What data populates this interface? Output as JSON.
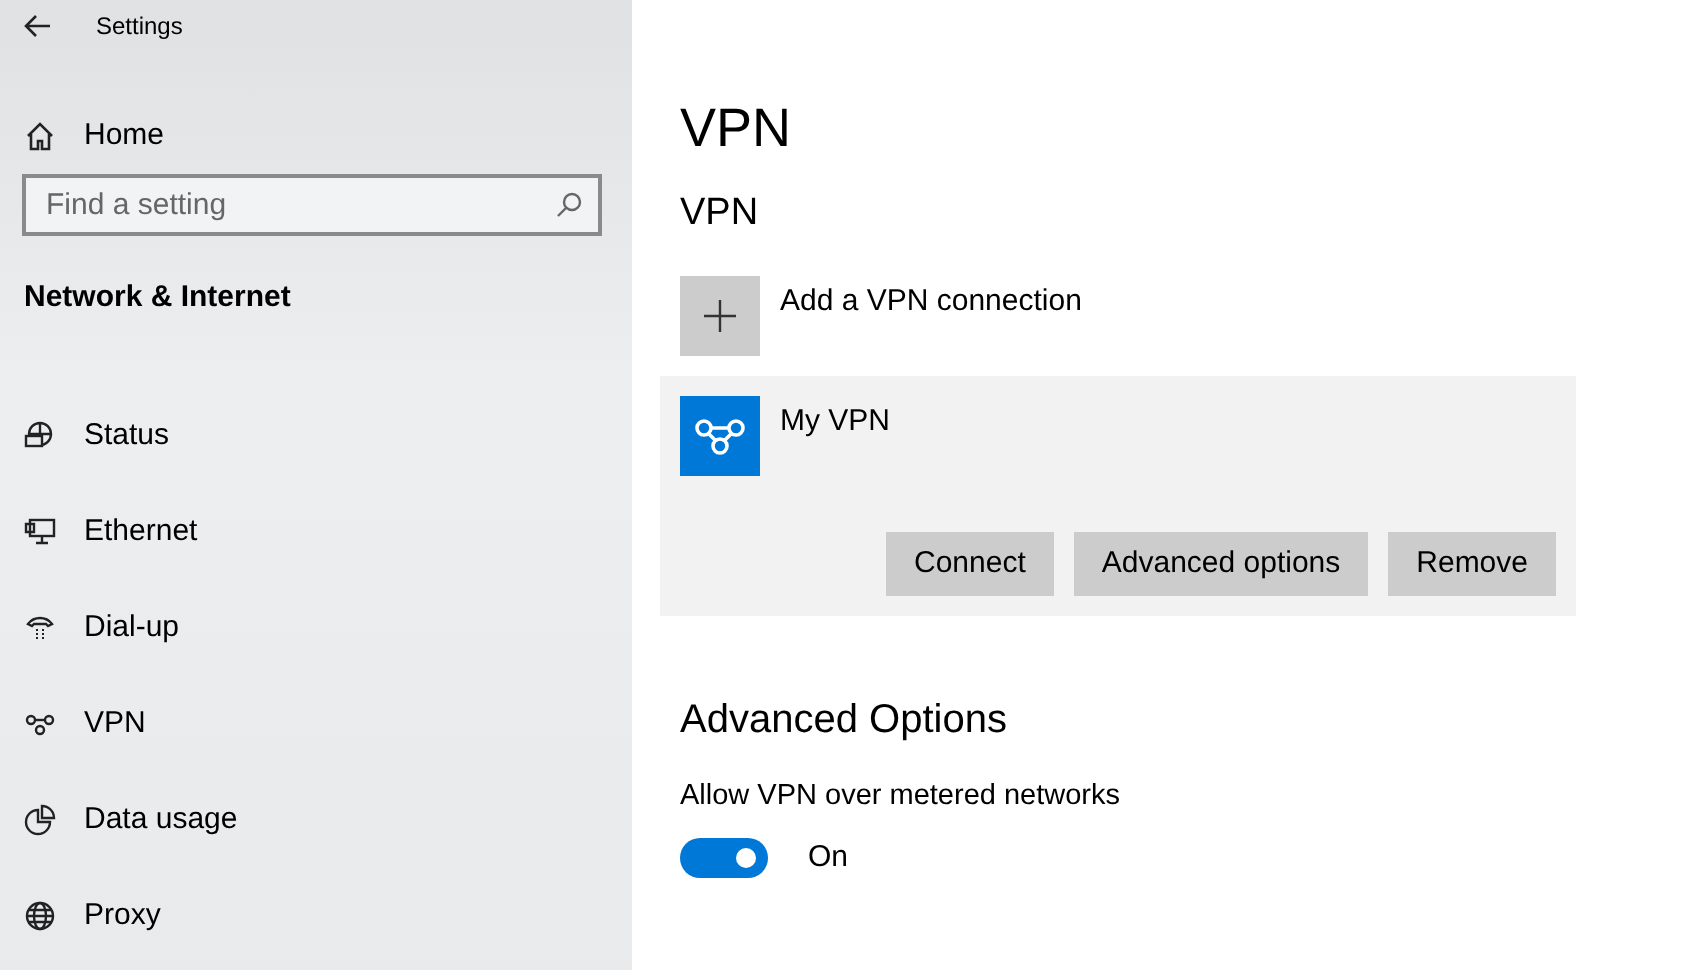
{
  "window": {
    "title": "Settings"
  },
  "sidebar": {
    "home": "Home",
    "search": {
      "placeholder": "Find a setting"
    },
    "section": "Network & Internet",
    "items": [
      {
        "label": "Status",
        "kind": "status"
      },
      {
        "label": "Ethernet",
        "kind": "ethernet"
      },
      {
        "label": "Dial-up",
        "kind": "dialup"
      },
      {
        "label": "VPN",
        "kind": "vpn"
      },
      {
        "label": "Data usage",
        "kind": "data"
      },
      {
        "label": "Proxy",
        "kind": "proxy"
      }
    ]
  },
  "main": {
    "title": "VPN",
    "subtitle": "VPN",
    "add_label": "Add a VPN connection",
    "connections": [
      {
        "name": "My VPN",
        "expanded": true,
        "buttons": [
          "Connect",
          "Advanced options",
          "Remove"
        ]
      }
    ],
    "advanced_title": "Advanced Options",
    "toggles": [
      {
        "label": "Allow VPN over metered networks",
        "on": true,
        "state_text": "On"
      }
    ]
  }
}
